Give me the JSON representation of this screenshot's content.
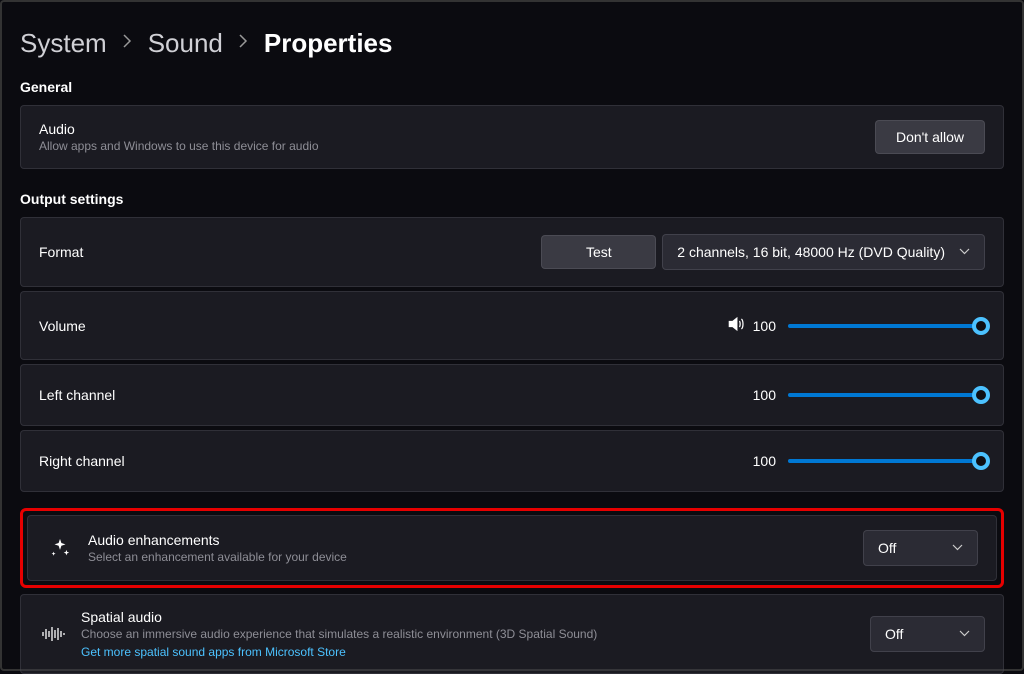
{
  "breadcrumb": {
    "item1": "System",
    "item2": "Sound",
    "item3": "Properties"
  },
  "general": {
    "header": "General",
    "audio": {
      "title": "Audio",
      "subtitle": "Allow apps and Windows to use this device for audio",
      "button": "Don't allow"
    }
  },
  "output": {
    "header": "Output settings",
    "format": {
      "title": "Format",
      "test": "Test",
      "selected": "2 channels, 16 bit, 48000 Hz (DVD Quality)"
    },
    "volume": {
      "title": "Volume",
      "value": "100"
    },
    "leftChannel": {
      "title": "Left channel",
      "value": "100"
    },
    "rightChannel": {
      "title": "Right channel",
      "value": "100"
    }
  },
  "enhancements": {
    "title": "Audio enhancements",
    "subtitle": "Select an enhancement available for your device",
    "value": "Off"
  },
  "spatial": {
    "title": "Spatial audio",
    "subtitle": "Choose an immersive audio experience that simulates a realistic environment (3D Spatial Sound)",
    "link": "Get more spatial sound apps from Microsoft Store",
    "value": "Off"
  }
}
